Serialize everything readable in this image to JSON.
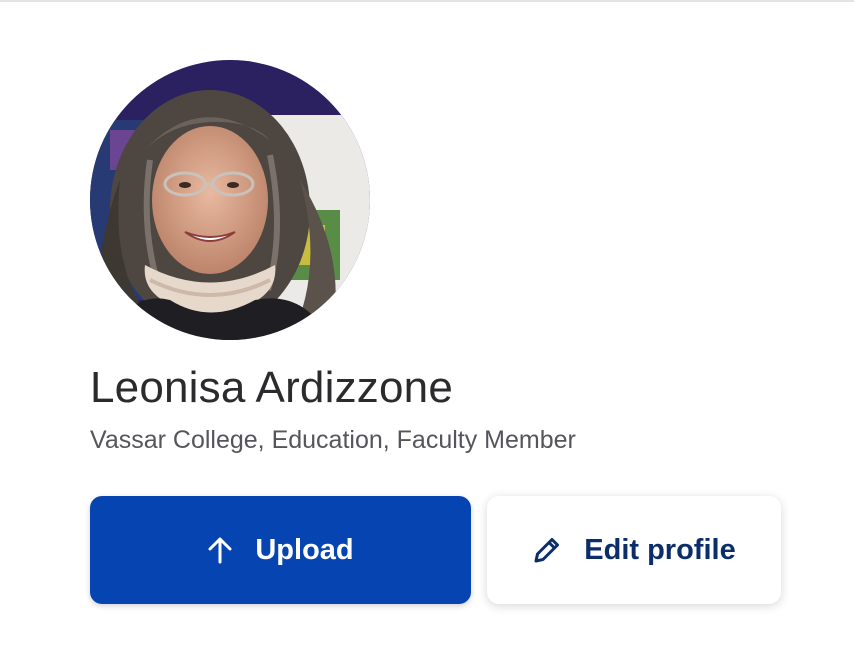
{
  "profile": {
    "name": "Leonisa Ardizzone",
    "affiliation": "Vassar College, Education, Faculty Member",
    "avatar_alt": "profile photo"
  },
  "actions": {
    "upload_label": "Upload",
    "upload_icon": "arrow-up-icon",
    "edit_label": "Edit profile",
    "edit_icon": "pencil-icon"
  },
  "colors": {
    "primary_button": "#0645b1",
    "secondary_text": "#0b2e6b",
    "name_text": "#2b2b2e",
    "affiliation_text": "#55555c"
  }
}
